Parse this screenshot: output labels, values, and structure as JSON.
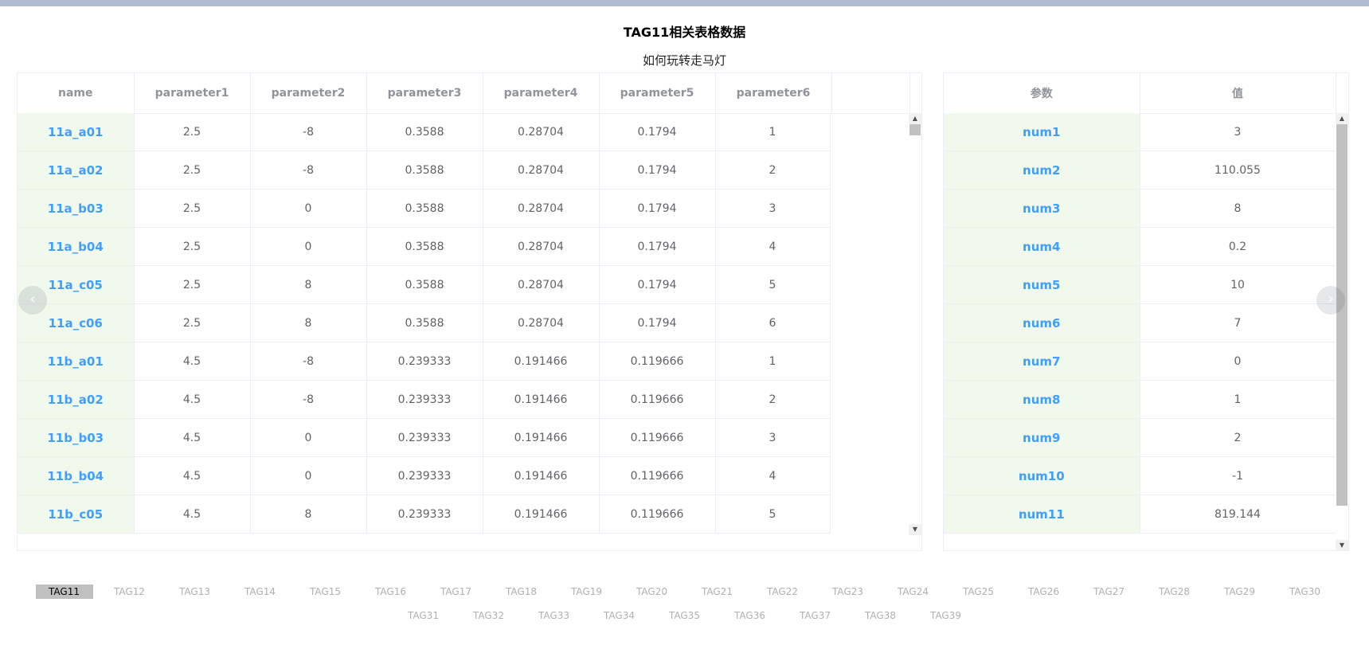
{
  "page": {
    "title": "TAG11相关表格数据",
    "subtitle": "如何玩转走马灯"
  },
  "main_table": {
    "columns": [
      "name",
      "parameter1",
      "parameter2",
      "parameter3",
      "parameter4",
      "parameter5",
      "parameter6"
    ],
    "rows": [
      [
        "11a_a01",
        "2.5",
        "-8",
        "0.3588",
        "0.28704",
        "0.1794",
        "1"
      ],
      [
        "11a_a02",
        "2.5",
        "-8",
        "0.3588",
        "0.28704",
        "0.1794",
        "2"
      ],
      [
        "11a_b03",
        "2.5",
        "0",
        "0.3588",
        "0.28704",
        "0.1794",
        "3"
      ],
      [
        "11a_b04",
        "2.5",
        "0",
        "0.3588",
        "0.28704",
        "0.1794",
        "4"
      ],
      [
        "11a_c05",
        "2.5",
        "8",
        "0.3588",
        "0.28704",
        "0.1794",
        "5"
      ],
      [
        "11a_c06",
        "2.5",
        "8",
        "0.3588",
        "0.28704",
        "0.1794",
        "6"
      ],
      [
        "11b_a01",
        "4.5",
        "-8",
        "0.239333",
        "0.191466",
        "0.119666",
        "1"
      ],
      [
        "11b_a02",
        "4.5",
        "-8",
        "0.239333",
        "0.191466",
        "0.119666",
        "2"
      ],
      [
        "11b_b03",
        "4.5",
        "0",
        "0.239333",
        "0.191466",
        "0.119666",
        "3"
      ],
      [
        "11b_b04",
        "4.5",
        "0",
        "0.239333",
        "0.191466",
        "0.119666",
        "4"
      ],
      [
        "11b_c05",
        "4.5",
        "8",
        "0.239333",
        "0.191466",
        "0.119666",
        "5"
      ]
    ]
  },
  "side_table": {
    "columns": [
      "参数",
      "值"
    ],
    "rows": [
      [
        "num1",
        "3"
      ],
      [
        "num2",
        "110.055"
      ],
      [
        "num3",
        "8"
      ],
      [
        "num4",
        "0.2"
      ],
      [
        "num5",
        "10"
      ],
      [
        "num6",
        "7"
      ],
      [
        "num7",
        "0"
      ],
      [
        "num8",
        "1"
      ],
      [
        "num9",
        "2"
      ],
      [
        "num10",
        "-1"
      ],
      [
        "num11",
        "819.144"
      ]
    ]
  },
  "scrollbars": {
    "main_scroll_fraction": 0.0,
    "side_scroll_fraction": 0.0
  },
  "carousel": {
    "prev_icon": "‹",
    "next_icon": "›"
  },
  "tags": {
    "active": "TAG11",
    "row1": [
      "TAG11",
      "TAG12",
      "TAG13",
      "TAG14",
      "TAG15",
      "TAG16",
      "TAG17",
      "TAG18",
      "TAG19",
      "TAG20",
      "TAG21",
      "TAG22",
      "TAG23",
      "TAG24",
      "TAG25",
      "TAG26",
      "TAG27",
      "TAG28",
      "TAG29",
      "TAG30"
    ],
    "row2": [
      "TAG31",
      "TAG32",
      "TAG33",
      "TAG34",
      "TAG35",
      "TAG36",
      "TAG37",
      "TAG38",
      "TAG39"
    ]
  },
  "colors": {
    "name_cell_bg": "#f0f9eb",
    "name_cell_text": "#409eff",
    "active_tag_bg": "#c0c0c0"
  }
}
